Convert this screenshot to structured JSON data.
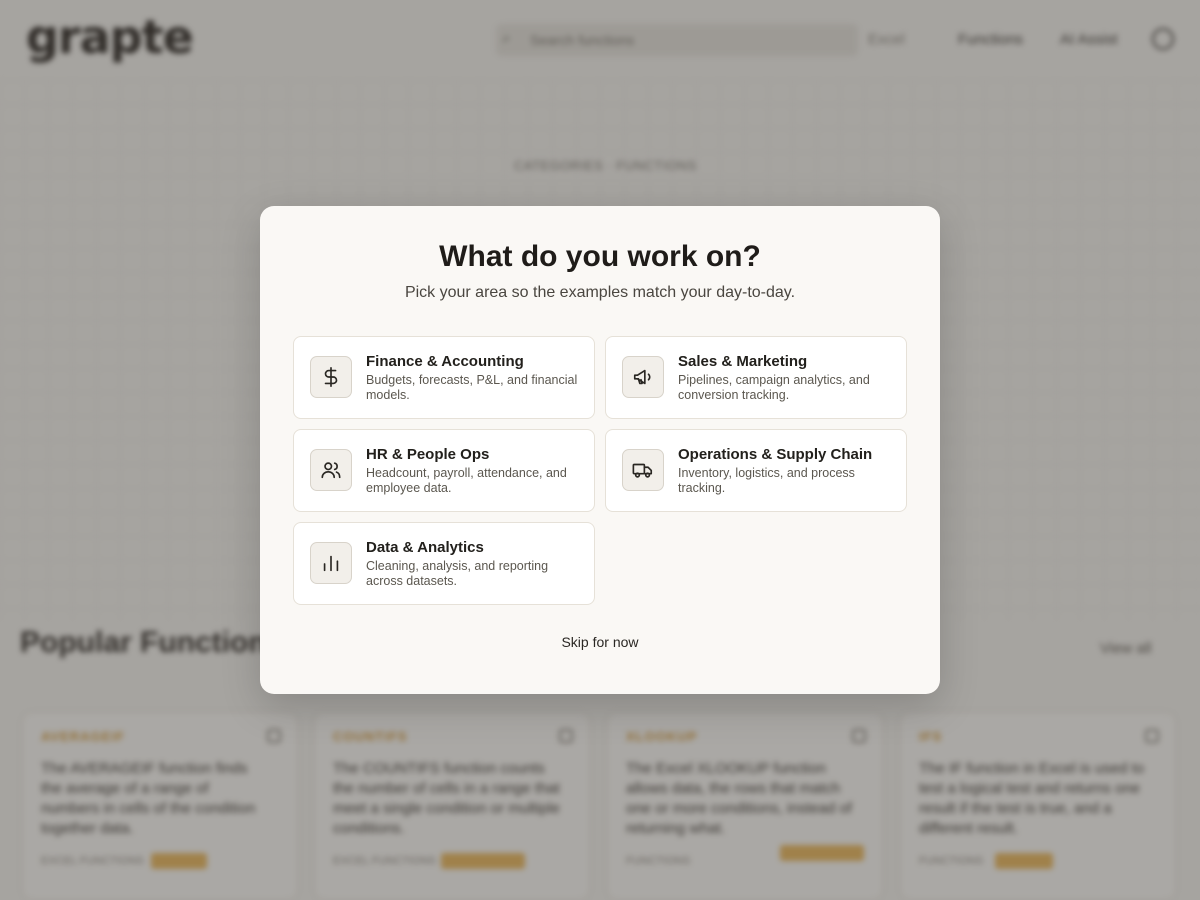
{
  "background": {
    "logo": "grapte",
    "search_placeholder": "Search functions",
    "nav": [
      "Excel",
      "Functions",
      "AI Assist"
    ],
    "hero_kicker": "CATEGORIES · FUNCTIONS",
    "section_title": "Popular Functions",
    "view_all": "View all",
    "cards": [
      {
        "tag": "AVERAGEIF",
        "body": "The AVERAGEIF function finds the average of a range of numbers in cells of the condition together data.",
        "meta": "EXCEL FUNCTIONS"
      },
      {
        "tag": "COUNTIFS",
        "body": "The COUNTIFS function counts the number of cells in a range that meet a single condition or multiple conditions.",
        "meta": "EXCEL FUNCTIONS"
      },
      {
        "tag": "XLOOKUP",
        "body": "The Excel XLOOKUP function allows data, the rows that match one or more conditions, instead of returning what.",
        "meta": "FUNCTIONS"
      },
      {
        "tag": "IFS",
        "body": "The IF function in Excel is used to test a logical test and returns one result if the test is true, and a different result.",
        "meta": "FUNCTIONS"
      }
    ]
  },
  "modal": {
    "title": "What do you work on?",
    "subtitle": "Pick your area so the examples match your day-to-day.",
    "skip_label": "Skip for now",
    "options": [
      {
        "icon": "dollar-icon",
        "title": "Finance & Accounting",
        "desc": "Budgets, forecasts, P&L, and financial models."
      },
      {
        "icon": "megaphone-icon",
        "title": "Sales & Marketing",
        "desc": "Pipelines, campaign analytics, and conversion tracking."
      },
      {
        "icon": "users-icon",
        "title": "HR & People Ops",
        "desc": "Headcount, payroll, attendance, and employee data."
      },
      {
        "icon": "truck-icon",
        "title": "Operations & Supply Chain",
        "desc": "Inventory, logistics, and process tracking."
      },
      {
        "icon": "bar-chart-icon",
        "title": "Data & Analytics",
        "desc": "Cleaning, analysis, and reporting across datasets."
      }
    ]
  }
}
